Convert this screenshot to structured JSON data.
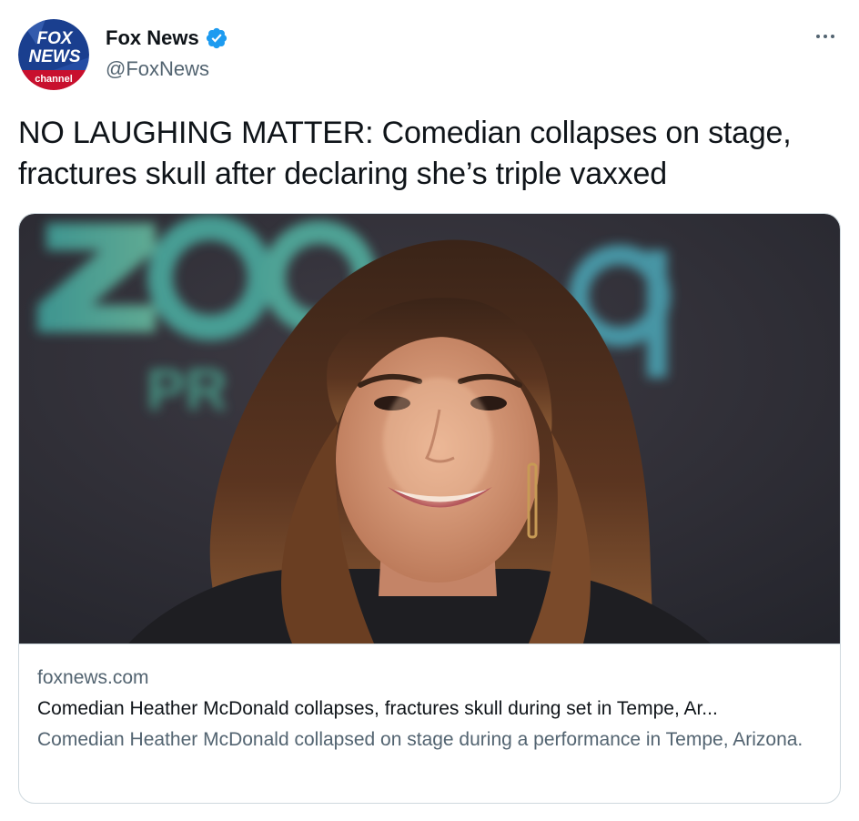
{
  "account": {
    "display_name": "Fox News",
    "handle": "@FoxNews",
    "verified": true,
    "avatar_icon": "fox-news-channel-logo",
    "avatar_text": [
      "FOX",
      "NEWS",
      "channel"
    ]
  },
  "tweet": {
    "text": "NO LAUGHING MATTER: Comedian collapses on stage, fractures skull after declaring she’s triple vaxxed"
  },
  "card": {
    "image_icon": "photo-woman-smiling-premiere",
    "domain": "foxnews.com",
    "title": "Comedian Heather McDonald collapses, fractures skull during set in Tempe, Ar...",
    "description": "Comedian Heather McDonald collapsed on stage during a performance in Tempe, Arizona."
  },
  "colors": {
    "text_primary": "#0f1419",
    "text_secondary": "#536471",
    "border": "#cfd9de",
    "verified_blue": "#1d9bf0",
    "fox_blue": "#1a3f8f",
    "fox_red": "#c8102e"
  }
}
